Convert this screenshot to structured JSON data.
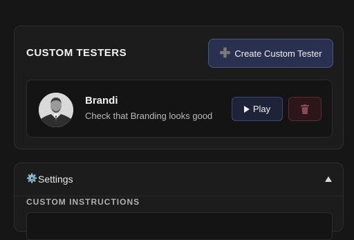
{
  "custom_testers": {
    "title": "CUSTOM TESTERS",
    "create_button": {
      "icon": "plus-icon",
      "label": "Create Custom Tester"
    },
    "testers": [
      {
        "name": "Brandi",
        "description": "Check that Branding looks good",
        "avatar": "avatar-photo",
        "play_button": {
          "icon": "play-icon",
          "label": "Play"
        },
        "delete_button": {
          "icon": "trash-icon"
        }
      }
    ]
  },
  "settings": {
    "icon": "gear-icon",
    "gear_glyph": "⚙️",
    "label": "Settings",
    "collapse_icon": "chevron-up-icon",
    "custom_instructions_label": "CUSTOM INSTRUCTIONS"
  },
  "colors": {
    "background": "#161616",
    "panel": "#1c1c1c",
    "primary_button": "#2a3150",
    "danger_button": "#2c1619"
  }
}
